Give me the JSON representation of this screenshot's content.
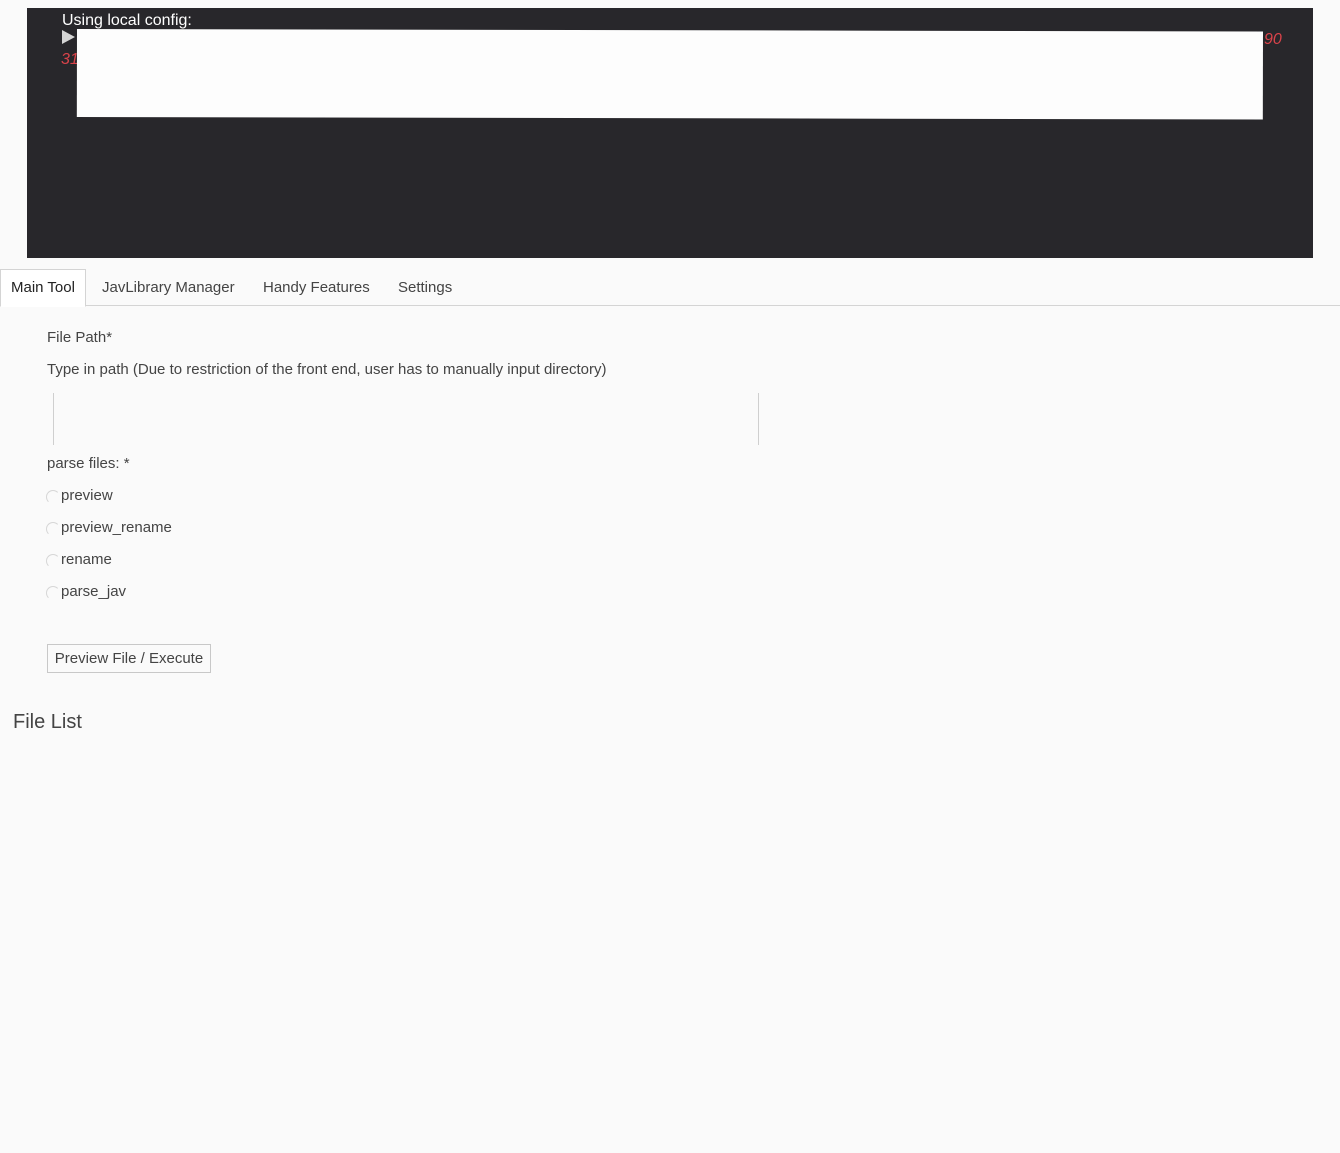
{
  "console": {
    "title": "Using local config:",
    "fragment_left": "31",
    "fragment_right": "90"
  },
  "tabs": [
    {
      "label": "Main Tool",
      "active": true
    },
    {
      "label": "JavLibrary Manager",
      "active": false
    },
    {
      "label": "Handy Features",
      "active": false
    },
    {
      "label": "Settings",
      "active": false
    }
  ],
  "form": {
    "file_path_label": "File Path*",
    "file_path_hint": "Type in path (Due to restriction of the front end, user has to manually input directory)",
    "file_path_value": "",
    "parse_files_label": "parse files: *",
    "options": [
      {
        "label": "preview",
        "selected": false
      },
      {
        "label": "preview_rename",
        "selected": false
      },
      {
        "label": "rename",
        "selected": false
      },
      {
        "label": "parse_jav",
        "selected": false
      }
    ],
    "submit_label": "Preview File / Execute"
  },
  "file_list": {
    "title": "File List"
  }
}
